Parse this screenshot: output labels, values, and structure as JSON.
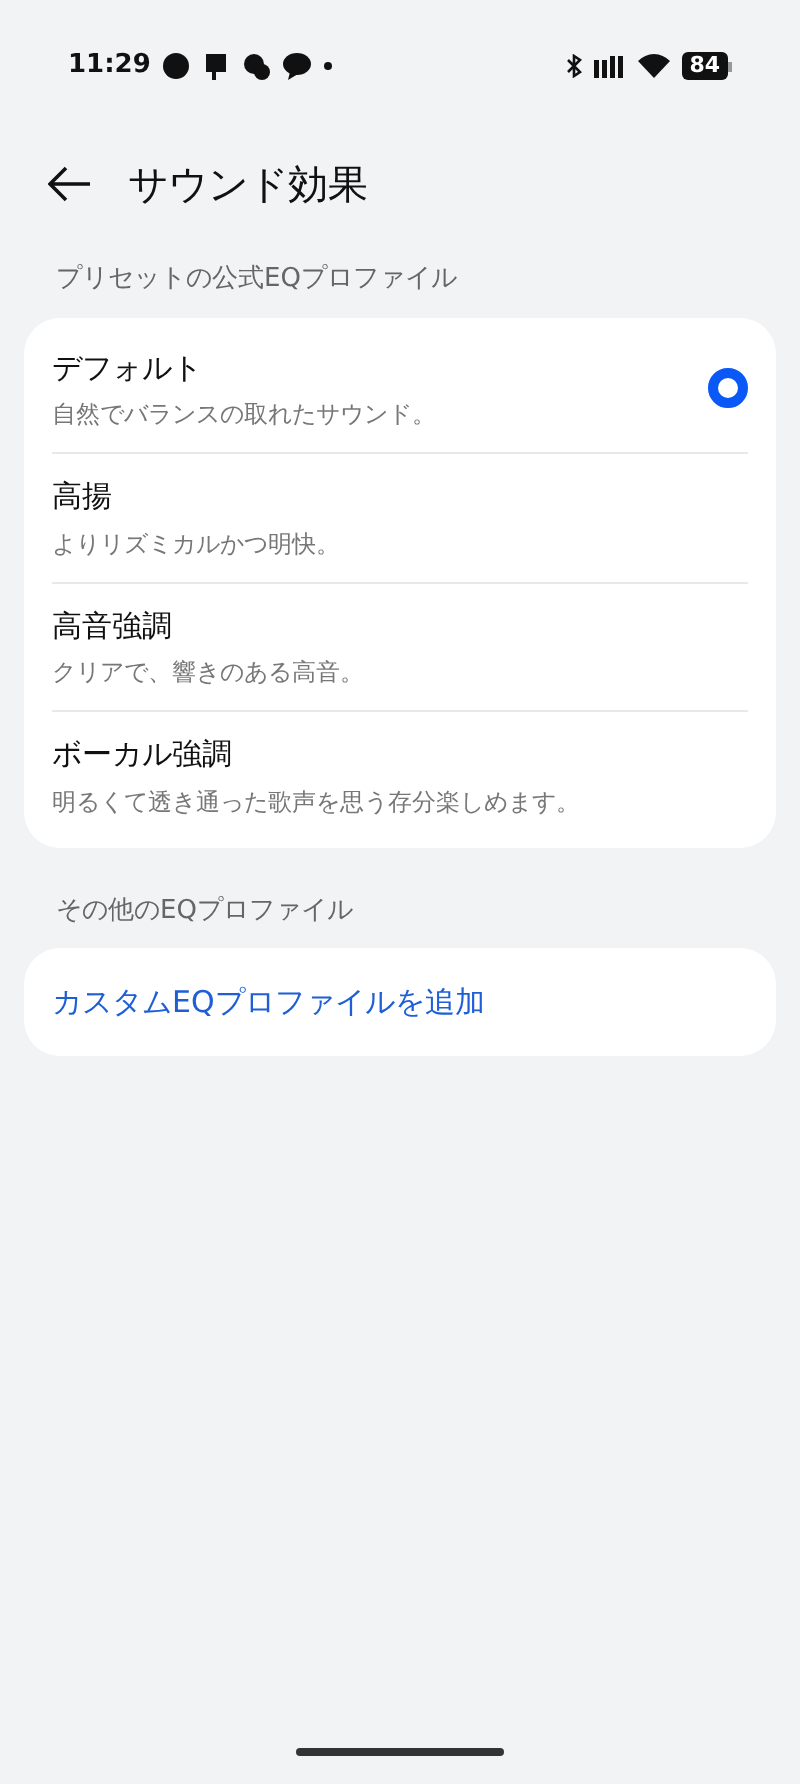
{
  "status_bar": {
    "time": "11:29",
    "battery": "84"
  },
  "header": {
    "title": "サウンド効果"
  },
  "sections": [
    {
      "label": "プリセットの公式EQプロファイル",
      "items": [
        {
          "title": "デフォルト",
          "subtitle": "自然でバランスの取れたサウンド。",
          "selected": true
        },
        {
          "title": "高揚",
          "subtitle": "よりリズミカルかつ明快。",
          "selected": false
        },
        {
          "title": "高音強調",
          "subtitle": "クリアで、響きのある高音。",
          "selected": false
        },
        {
          "title": "ボーカル強調",
          "subtitle": "明るくて透き通った歌声を思う存分楽しめます。",
          "selected": false
        }
      ]
    },
    {
      "label": "その他のEQプロファイル",
      "action": "カスタムEQプロファイルを追加"
    }
  ]
}
